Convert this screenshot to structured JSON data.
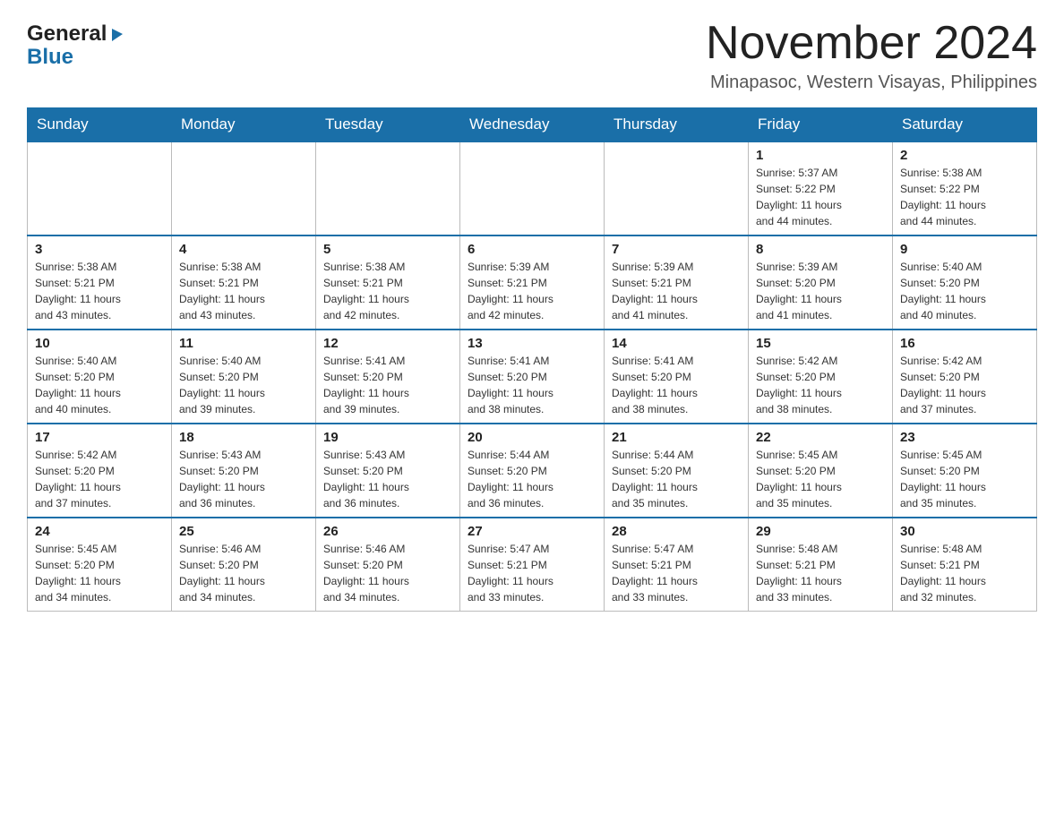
{
  "header": {
    "logo": {
      "general": "General",
      "blue": "Blue",
      "triangle": "▶"
    },
    "title": "November 2024",
    "location": "Minapasoc, Western Visayas, Philippines"
  },
  "calendar": {
    "days_of_week": [
      "Sunday",
      "Monday",
      "Tuesday",
      "Wednesday",
      "Thursday",
      "Friday",
      "Saturday"
    ],
    "weeks": [
      [
        {
          "day": "",
          "info": ""
        },
        {
          "day": "",
          "info": ""
        },
        {
          "day": "",
          "info": ""
        },
        {
          "day": "",
          "info": ""
        },
        {
          "day": "",
          "info": ""
        },
        {
          "day": "1",
          "info": "Sunrise: 5:37 AM\nSunset: 5:22 PM\nDaylight: 11 hours\nand 44 minutes."
        },
        {
          "day": "2",
          "info": "Sunrise: 5:38 AM\nSunset: 5:22 PM\nDaylight: 11 hours\nand 44 minutes."
        }
      ],
      [
        {
          "day": "3",
          "info": "Sunrise: 5:38 AM\nSunset: 5:21 PM\nDaylight: 11 hours\nand 43 minutes."
        },
        {
          "day": "4",
          "info": "Sunrise: 5:38 AM\nSunset: 5:21 PM\nDaylight: 11 hours\nand 43 minutes."
        },
        {
          "day": "5",
          "info": "Sunrise: 5:38 AM\nSunset: 5:21 PM\nDaylight: 11 hours\nand 42 minutes."
        },
        {
          "day": "6",
          "info": "Sunrise: 5:39 AM\nSunset: 5:21 PM\nDaylight: 11 hours\nand 42 minutes."
        },
        {
          "day": "7",
          "info": "Sunrise: 5:39 AM\nSunset: 5:21 PM\nDaylight: 11 hours\nand 41 minutes."
        },
        {
          "day": "8",
          "info": "Sunrise: 5:39 AM\nSunset: 5:20 PM\nDaylight: 11 hours\nand 41 minutes."
        },
        {
          "day": "9",
          "info": "Sunrise: 5:40 AM\nSunset: 5:20 PM\nDaylight: 11 hours\nand 40 minutes."
        }
      ],
      [
        {
          "day": "10",
          "info": "Sunrise: 5:40 AM\nSunset: 5:20 PM\nDaylight: 11 hours\nand 40 minutes."
        },
        {
          "day": "11",
          "info": "Sunrise: 5:40 AM\nSunset: 5:20 PM\nDaylight: 11 hours\nand 39 minutes."
        },
        {
          "day": "12",
          "info": "Sunrise: 5:41 AM\nSunset: 5:20 PM\nDaylight: 11 hours\nand 39 minutes."
        },
        {
          "day": "13",
          "info": "Sunrise: 5:41 AM\nSunset: 5:20 PM\nDaylight: 11 hours\nand 38 minutes."
        },
        {
          "day": "14",
          "info": "Sunrise: 5:41 AM\nSunset: 5:20 PM\nDaylight: 11 hours\nand 38 minutes."
        },
        {
          "day": "15",
          "info": "Sunrise: 5:42 AM\nSunset: 5:20 PM\nDaylight: 11 hours\nand 38 minutes."
        },
        {
          "day": "16",
          "info": "Sunrise: 5:42 AM\nSunset: 5:20 PM\nDaylight: 11 hours\nand 37 minutes."
        }
      ],
      [
        {
          "day": "17",
          "info": "Sunrise: 5:42 AM\nSunset: 5:20 PM\nDaylight: 11 hours\nand 37 minutes."
        },
        {
          "day": "18",
          "info": "Sunrise: 5:43 AM\nSunset: 5:20 PM\nDaylight: 11 hours\nand 36 minutes."
        },
        {
          "day": "19",
          "info": "Sunrise: 5:43 AM\nSunset: 5:20 PM\nDaylight: 11 hours\nand 36 minutes."
        },
        {
          "day": "20",
          "info": "Sunrise: 5:44 AM\nSunset: 5:20 PM\nDaylight: 11 hours\nand 36 minutes."
        },
        {
          "day": "21",
          "info": "Sunrise: 5:44 AM\nSunset: 5:20 PM\nDaylight: 11 hours\nand 35 minutes."
        },
        {
          "day": "22",
          "info": "Sunrise: 5:45 AM\nSunset: 5:20 PM\nDaylight: 11 hours\nand 35 minutes."
        },
        {
          "day": "23",
          "info": "Sunrise: 5:45 AM\nSunset: 5:20 PM\nDaylight: 11 hours\nand 35 minutes."
        }
      ],
      [
        {
          "day": "24",
          "info": "Sunrise: 5:45 AM\nSunset: 5:20 PM\nDaylight: 11 hours\nand 34 minutes."
        },
        {
          "day": "25",
          "info": "Sunrise: 5:46 AM\nSunset: 5:20 PM\nDaylight: 11 hours\nand 34 minutes."
        },
        {
          "day": "26",
          "info": "Sunrise: 5:46 AM\nSunset: 5:20 PM\nDaylight: 11 hours\nand 34 minutes."
        },
        {
          "day": "27",
          "info": "Sunrise: 5:47 AM\nSunset: 5:21 PM\nDaylight: 11 hours\nand 33 minutes."
        },
        {
          "day": "28",
          "info": "Sunrise: 5:47 AM\nSunset: 5:21 PM\nDaylight: 11 hours\nand 33 minutes."
        },
        {
          "day": "29",
          "info": "Sunrise: 5:48 AM\nSunset: 5:21 PM\nDaylight: 11 hours\nand 33 minutes."
        },
        {
          "day": "30",
          "info": "Sunrise: 5:48 AM\nSunset: 5:21 PM\nDaylight: 11 hours\nand 32 minutes."
        }
      ]
    ]
  }
}
